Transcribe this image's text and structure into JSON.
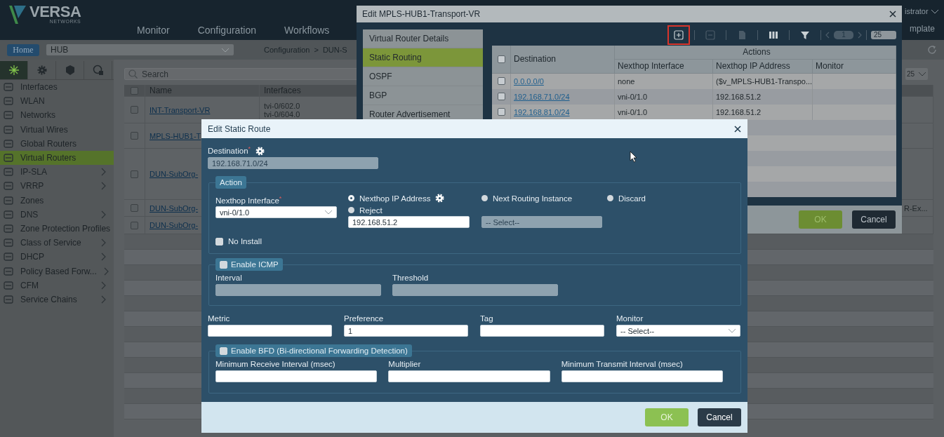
{
  "header": {
    "logo": "VERSA",
    "logo_sub": "NETWORKS",
    "nav": [
      "Monitor",
      "Configuration",
      "Workflows"
    ],
    "user": "istrator",
    "template_link": "mplate"
  },
  "subbar": {
    "home": "Home",
    "org": "HUB",
    "breadcrumb": [
      "Configuration",
      ">",
      "DUN-S"
    ]
  },
  "sidebar": {
    "tabs": [
      {
        "selected": true
      },
      {
        "selected": false
      },
      {
        "selected": false
      },
      {
        "selected": false
      }
    ],
    "items": [
      {
        "label": "Interfaces",
        "selected": false,
        "has_children": false
      },
      {
        "label": "WLAN",
        "selected": false,
        "has_children": false
      },
      {
        "label": "Networks",
        "selected": false,
        "has_children": false
      },
      {
        "label": "Virtual Wires",
        "selected": false,
        "has_children": false
      },
      {
        "label": "Global Routers",
        "selected": false,
        "has_children": false
      },
      {
        "label": "Virtual Routers",
        "selected": true,
        "has_children": false
      },
      {
        "label": "IP-SLA",
        "selected": false,
        "has_children": true
      },
      {
        "label": "VRRP",
        "selected": false,
        "has_children": true
      },
      {
        "label": "Zones",
        "selected": false,
        "has_children": false
      },
      {
        "label": "DNS",
        "selected": false,
        "has_children": true
      },
      {
        "label": "Zone Protection Profiles",
        "selected": false,
        "has_children": false
      },
      {
        "label": "Class of Service",
        "selected": false,
        "has_children": true
      },
      {
        "label": "DHCP",
        "selected": false,
        "has_children": true
      },
      {
        "label": "Policy Based Forw...",
        "selected": false,
        "has_children": true
      },
      {
        "label": "CFM",
        "selected": false,
        "has_children": true
      },
      {
        "label": "Service Chains",
        "selected": false,
        "has_children": true
      }
    ]
  },
  "main": {
    "search_placeholder": "Search",
    "page_size": "25",
    "header_checked": false,
    "columns": [
      "Name",
      "Interfaces"
    ],
    "rows": [
      {
        "checked": false,
        "name": "INT-Transport-VR",
        "interfaces": [
          "tvi-0/602.0",
          "tvi-0/604.0"
        ]
      },
      {
        "checked": false,
        "name": "MPLS-HUB1-T"
      },
      {
        "checked": false,
        "name": "DUN-SubOrg-"
      },
      {
        "checked": false,
        "name": "DUN-SubOrg-",
        "column_4": "R-Ex..."
      },
      {
        "checked": false,
        "name": "DUN-SubOrg-"
      }
    ]
  },
  "vr_dialog": {
    "title": "Edit MPLS-HUB1-Transport-VR",
    "menu": [
      {
        "label": "Virtual Router Details",
        "selected": false
      },
      {
        "label": "Static Routing",
        "selected": true
      },
      {
        "label": "OSPF",
        "selected": false
      },
      {
        "label": "BGP",
        "selected": false
      },
      {
        "label": "Router Advertisement",
        "selected": false
      }
    ],
    "toolbar": {
      "tools": [
        {
          "kind": "add",
          "disabled": false,
          "highlighted": true
        },
        {
          "kind": "remove",
          "disabled": true,
          "highlighted": false
        },
        {
          "kind": "clone",
          "disabled": true,
          "highlighted": false
        },
        {
          "kind": "columns",
          "disabled": false,
          "highlighted": false
        },
        {
          "kind": "filter",
          "disabled": false,
          "highlighted": false
        }
      ],
      "page": "1",
      "page_size": "25"
    },
    "table": {
      "header_checked": false,
      "group_header": "Actions",
      "columns": [
        "Destination",
        "Nexthop Interface",
        "Nexthop IP Address",
        "Monitor"
      ],
      "rows": [
        {
          "checked": false,
          "destination": "0.0.0.0/0",
          "nexthop_interface": "none",
          "nexthop_ip": "($v_MPLS-HUB1-Transpo..."
        },
        {
          "checked": false,
          "destination": "192.168.71.0/24",
          "nexthop_interface": "vni-0/1.0",
          "nexthop_ip": "192.168.51.2"
        },
        {
          "checked": false,
          "destination": "192.168.81.0/24",
          "nexthop_interface": "vni-0/1.0",
          "nexthop_ip": "192.168.51.2"
        }
      ]
    },
    "buttons": [
      {
        "label": "OK",
        "kind": "primary"
      },
      {
        "label": "Cancel",
        "kind": "secondary"
      }
    ]
  },
  "route_dialog": {
    "title": "Edit Static Route",
    "destination": {
      "label": "Destination",
      "required": "*",
      "value": "192.168.71.0/24",
      "disabled": true
    },
    "action": {
      "legend": "Action",
      "nexthop_interface": {
        "label": "Nexthop Interface",
        "required": "*",
        "value": "vni-0/1.0"
      },
      "options": [
        {
          "label": "Nexthop IP Address",
          "selected": true
        },
        {
          "label": "Reject",
          "selected": false
        },
        {
          "label": "Next Routing Instance",
          "selected": false
        },
        {
          "label": "Discard",
          "selected": false
        }
      ],
      "nexthop_ip": "192.168.51.2",
      "routing_instance": {
        "value": "-- Select--",
        "disabled": true
      },
      "no_install": {
        "label": "No Install",
        "checked": false
      }
    },
    "icmp": {
      "label": "Enable ICMP",
      "checked": false,
      "fields": [
        {
          "label": "Interval",
          "disabled": true
        },
        {
          "label": "Threshold",
          "disabled": true
        }
      ]
    },
    "fields": [
      {
        "label": "Metric",
        "kind": "input"
      },
      {
        "label": "Preference",
        "kind": "input",
        "value": "1"
      },
      {
        "label": "Tag",
        "kind": "input"
      },
      {
        "label": "Monitor",
        "kind": "select",
        "value": "-- Select--"
      }
    ],
    "bfd": {
      "label": "Enable BFD (Bi-directional Forwarding Detection)",
      "checked": false,
      "fields": [
        {
          "label": "Minimum Receive Interval (msec)",
          "disabled": false
        },
        {
          "label": "Multiplier",
          "disabled": false
        },
        {
          "label": "Minimum Transmit Interval (msec)",
          "disabled": false
        }
      ]
    },
    "buttons": [
      {
        "label": "OK",
        "kind": "primary"
      },
      {
        "label": "Cancel",
        "kind": "secondary"
      }
    ]
  }
}
